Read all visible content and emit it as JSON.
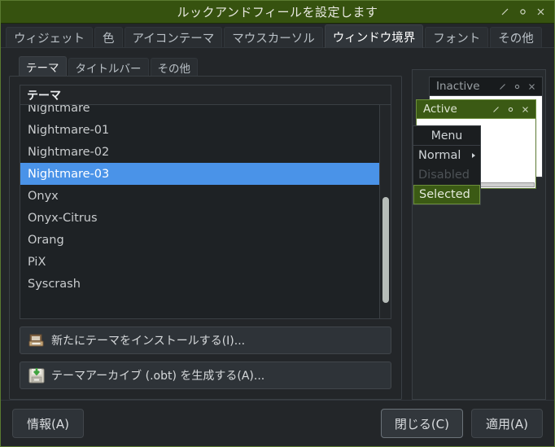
{
  "window": {
    "title": "ルックアンドフィールを設定します",
    "title_bg": "#36520f",
    "buttons": [
      {
        "name": "minimize",
        "glyph": "minimize-icon"
      },
      {
        "name": "maximize",
        "glyph": "maximize-icon"
      },
      {
        "name": "close",
        "glyph": "close-icon"
      }
    ]
  },
  "tabs": [
    {
      "label": "ウィジェット",
      "selected": false
    },
    {
      "label": "色",
      "selected": false
    },
    {
      "label": "アイコンテーマ",
      "selected": false
    },
    {
      "label": "マウスカーソル",
      "selected": false
    },
    {
      "label": "ウィンドウ境界",
      "selected": true
    },
    {
      "label": "フォント",
      "selected": false
    },
    {
      "label": "その他",
      "selected": false
    }
  ],
  "subtabs": [
    {
      "label": "テーマ",
      "selected": true
    },
    {
      "label": "タイトルバー",
      "selected": false
    },
    {
      "label": "その他",
      "selected": false
    }
  ],
  "theme_list": {
    "header": "テーマ",
    "selected_value": "Nightmare-03",
    "selection_color": "#4a93e8",
    "items": [
      {
        "label": "Nightmare",
        "selected": false
      },
      {
        "label": "Nightmare-01",
        "selected": false
      },
      {
        "label": "Nightmare-02",
        "selected": false
      },
      {
        "label": "Nightmare-03",
        "selected": true
      },
      {
        "label": "Onyx",
        "selected": false
      },
      {
        "label": "Onyx-Citrus",
        "selected": false
      },
      {
        "label": "Orang",
        "selected": false
      },
      {
        "label": "PiX",
        "selected": false
      },
      {
        "label": "Syscrash",
        "selected": false
      }
    ]
  },
  "actions": {
    "install": {
      "label": "新たにテーマをインストールする(I)...",
      "icon": "install-archive-icon"
    },
    "create": {
      "label": "テーマアーカイブ (.obt) を生成する(A)...",
      "icon": "save-disk-icon"
    }
  },
  "preview": {
    "inactive_title": "Inactive",
    "active_title": "Active",
    "menu_title": "Menu",
    "menu_items": [
      {
        "label": "Normal",
        "state": "normal",
        "has_submenu": true
      },
      {
        "label": "Disabled",
        "state": "disabled",
        "has_submenu": false
      },
      {
        "label": "Selected",
        "state": "selected",
        "has_submenu": false
      }
    ],
    "active_color": "#3b5a14",
    "selected_color": "#3b5a14"
  },
  "footer": {
    "info": "情報(A)",
    "close": "閉じる(C)",
    "apply": "適用(A)"
  }
}
